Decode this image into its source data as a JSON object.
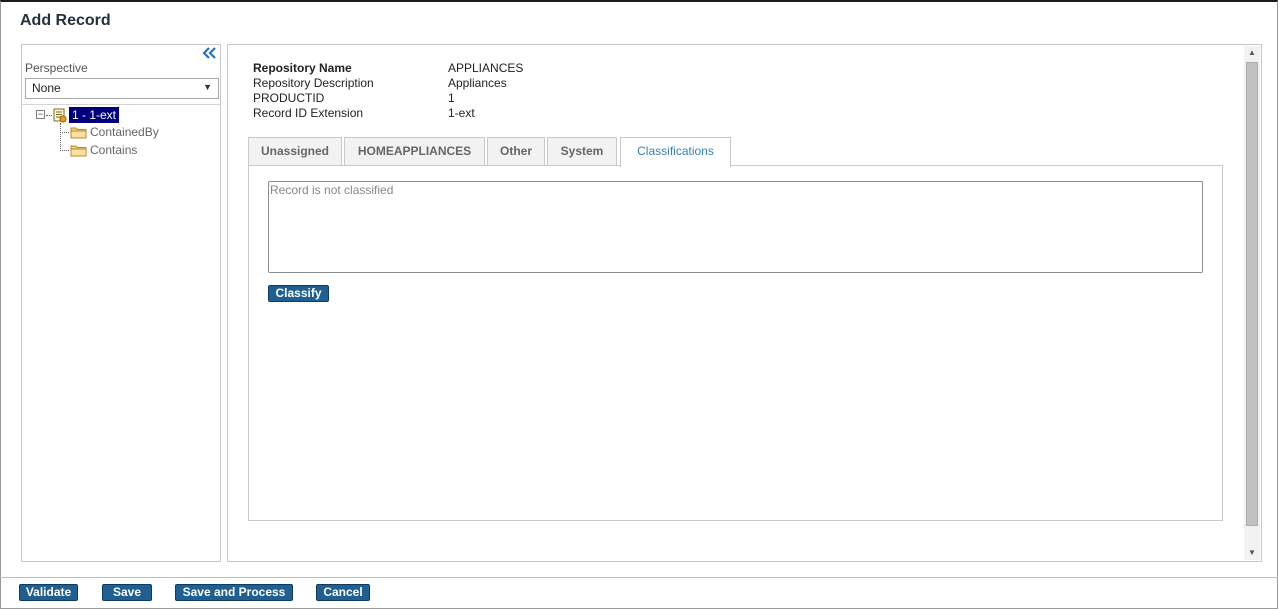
{
  "window": {
    "title": "Add Record"
  },
  "sidebar": {
    "perspective_label": "Perspective",
    "perspective_value": "None",
    "tree": {
      "root_label": "1 - 1-ext",
      "children": [
        "ContainedBy",
        "Contains"
      ]
    }
  },
  "record_info": {
    "rows": [
      {
        "key": "Repository Name",
        "value": "APPLIANCES"
      },
      {
        "key": "Repository Description",
        "value": "Appliances"
      },
      {
        "key": "PRODUCTID",
        "value": "1"
      },
      {
        "key": "Record ID Extension",
        "value": "1-ext"
      }
    ]
  },
  "tabs": [
    {
      "label": "Unassigned"
    },
    {
      "label": "HOMEAPPLIANCES"
    },
    {
      "label": "Other"
    },
    {
      "label": "System"
    },
    {
      "label": "Classifications"
    }
  ],
  "active_tab": "Classifications",
  "classifications": {
    "text": "Record is not classified",
    "classify_label": "Classify"
  },
  "footer": {
    "validate_label": "Validate",
    "save_label": "Save",
    "save_process_label": "Save and Process",
    "cancel_label": "Cancel"
  },
  "colors": {
    "button_bg": "#1f5f91",
    "selected_tree_bg": "#00007f",
    "active_tab_text": "#3b7fb8"
  }
}
